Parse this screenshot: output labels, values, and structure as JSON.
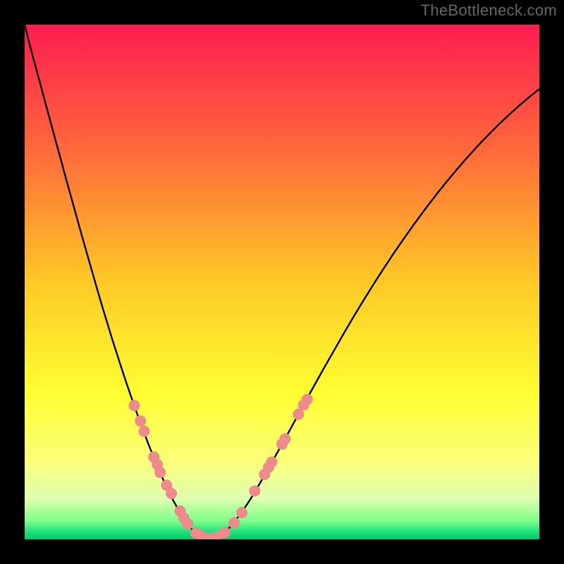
{
  "watermark": "TheBottleneck.com",
  "chart_data": {
    "type": "line",
    "title": "",
    "xlabel": "",
    "ylabel": "",
    "xlim": [
      0,
      100
    ],
    "ylim": [
      0,
      100
    ],
    "grid": false,
    "gradient_stops": [
      {
        "offset": 0.0,
        "color": "#ff1c51"
      },
      {
        "offset": 0.25,
        "color": "#ff6b3a"
      },
      {
        "offset": 0.5,
        "color": "#ffc926"
      },
      {
        "offset": 0.72,
        "color": "#ffff33"
      },
      {
        "offset": 0.85,
        "color": "#fbff7a"
      },
      {
        "offset": 0.92,
        "color": "#e0ffb0"
      },
      {
        "offset": 0.965,
        "color": "#7cff8a"
      },
      {
        "offset": 0.985,
        "color": "#1fe27a"
      },
      {
        "offset": 1.0,
        "color": "#00c870"
      }
    ],
    "curve": {
      "x": [
        0,
        1,
        2,
        3,
        4,
        5,
        6,
        7,
        8,
        9,
        10,
        11,
        12,
        13,
        14,
        15,
        16,
        17,
        18,
        19,
        20,
        21,
        22,
        23,
        24,
        25,
        26,
        27,
        28,
        29,
        30,
        31,
        32,
        33,
        34,
        35,
        36,
        37,
        38,
        39,
        40,
        42,
        44,
        46,
        48,
        50,
        52,
        54,
        56,
        58,
        60,
        62,
        64,
        66,
        68,
        70,
        72,
        74,
        76,
        78,
        80,
        82,
        84,
        86,
        88,
        90,
        92,
        94,
        96,
        98,
        100
      ],
      "y": [
        100,
        96.0,
        92.3,
        88.6,
        84.9,
        81.2,
        77.5,
        73.9,
        70.2,
        66.6,
        63.0,
        59.4,
        55.9,
        52.4,
        48.9,
        45.5,
        42.2,
        38.9,
        35.8,
        32.7,
        29.7,
        26.8,
        24.0,
        21.3,
        18.6,
        16.1,
        13.7,
        11.4,
        9.3,
        7.3,
        5.5,
        3.9,
        2.5,
        1.4,
        0.6,
        0.1,
        0.0,
        0.1,
        0.6,
        1.4,
        2.5,
        5.0,
        8.0,
        11.4,
        14.9,
        18.5,
        22.1,
        25.8,
        29.4,
        33.0,
        36.5,
        40.0,
        43.4,
        46.7,
        49.9,
        53.0,
        56.0,
        58.9,
        61.7,
        64.4,
        67.0,
        69.5,
        71.9,
        74.2,
        76.4,
        78.5,
        80.5,
        82.4,
        84.2,
        85.9,
        87.5
      ]
    },
    "series": [
      {
        "name": "markers",
        "points": [
          {
            "x": 21.3,
            "y": 26.0
          },
          {
            "x": 22.5,
            "y": 23.0
          },
          {
            "x": 23.2,
            "y": 21.0
          },
          {
            "x": 25.1,
            "y": 16.0
          },
          {
            "x": 25.8,
            "y": 14.5
          },
          {
            "x": 26.3,
            "y": 13.0
          },
          {
            "x": 27.6,
            "y": 10.5
          },
          {
            "x": 28.5,
            "y": 8.9
          },
          {
            "x": 30.2,
            "y": 5.5
          },
          {
            "x": 30.9,
            "y": 4.2
          },
          {
            "x": 31.7,
            "y": 3.0
          },
          {
            "x": 33.3,
            "y": 1.2
          },
          {
            "x": 34.2,
            "y": 0.7
          },
          {
            "x": 35.0,
            "y": 0.2
          },
          {
            "x": 35.8,
            "y": 0.1
          },
          {
            "x": 36.6,
            "y": 0.2
          },
          {
            "x": 37.5,
            "y": 0.5
          },
          {
            "x": 38.9,
            "y": 1.3
          },
          {
            "x": 40.7,
            "y": 3.2
          },
          {
            "x": 42.2,
            "y": 5.2
          },
          {
            "x": 44.7,
            "y": 9.4
          },
          {
            "x": 46.6,
            "y": 12.6
          },
          {
            "x": 47.4,
            "y": 14.0
          },
          {
            "x": 48.0,
            "y": 15.0
          },
          {
            "x": 50.0,
            "y": 18.5
          },
          {
            "x": 50.6,
            "y": 19.5
          },
          {
            "x": 53.2,
            "y": 24.3
          },
          {
            "x": 54.2,
            "y": 26.1
          },
          {
            "x": 54.9,
            "y": 27.2
          }
        ],
        "marker_color": "#ed8a8c",
        "marker_radius_px": 8
      }
    ]
  }
}
